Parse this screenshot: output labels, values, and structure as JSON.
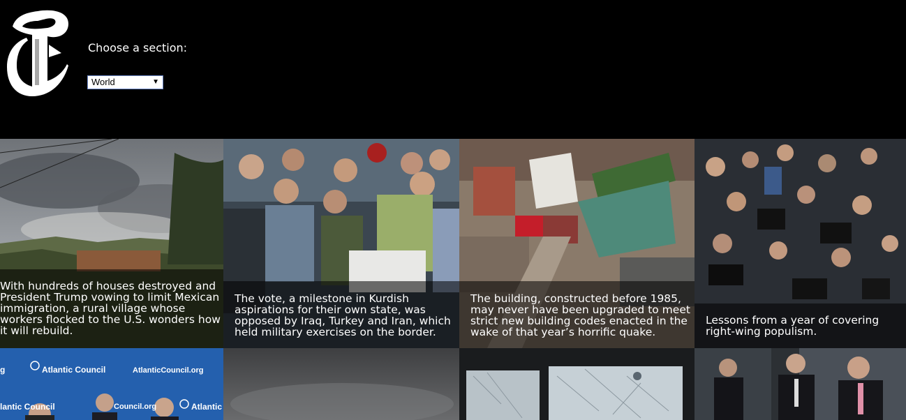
{
  "header": {
    "section_label": "Choose a section:",
    "section_select": {
      "value": "World"
    }
  },
  "stories": [
    {
      "caption": "With hundreds of houses destroyed and President Trump vowing to limit Mexican immigration, a rural village whose workers flocked to the U.S. wonders how it will rebuild."
    },
    {
      "caption": "The vote, a milestone in Kurdish aspirations for their own state, was opposed by Iraq, Turkey and Iran, which held military exercises on the border."
    },
    {
      "caption": "The building, constructed before 1985, may never have been upgraded to meet strict new building codes enacted in the wake of that year’s horrific quake."
    },
    {
      "caption": "Lessons from a year of covering right-wing populism."
    }
  ],
  "second_row": {
    "atlantic_council": {
      "brand": "Atlantic Council",
      "url": "AtlanticCouncil.org",
      "partial_left": "g",
      "partial_bottom_left": "lantic Council",
      "partial_bottom_mid": "Council.org",
      "partial_bottom_right": "Atlantic"
    }
  },
  "colors": {
    "background": "#000000",
    "caption_overlay": "rgba(0,0,0,0.55)",
    "select_border": "#6a86c7"
  }
}
